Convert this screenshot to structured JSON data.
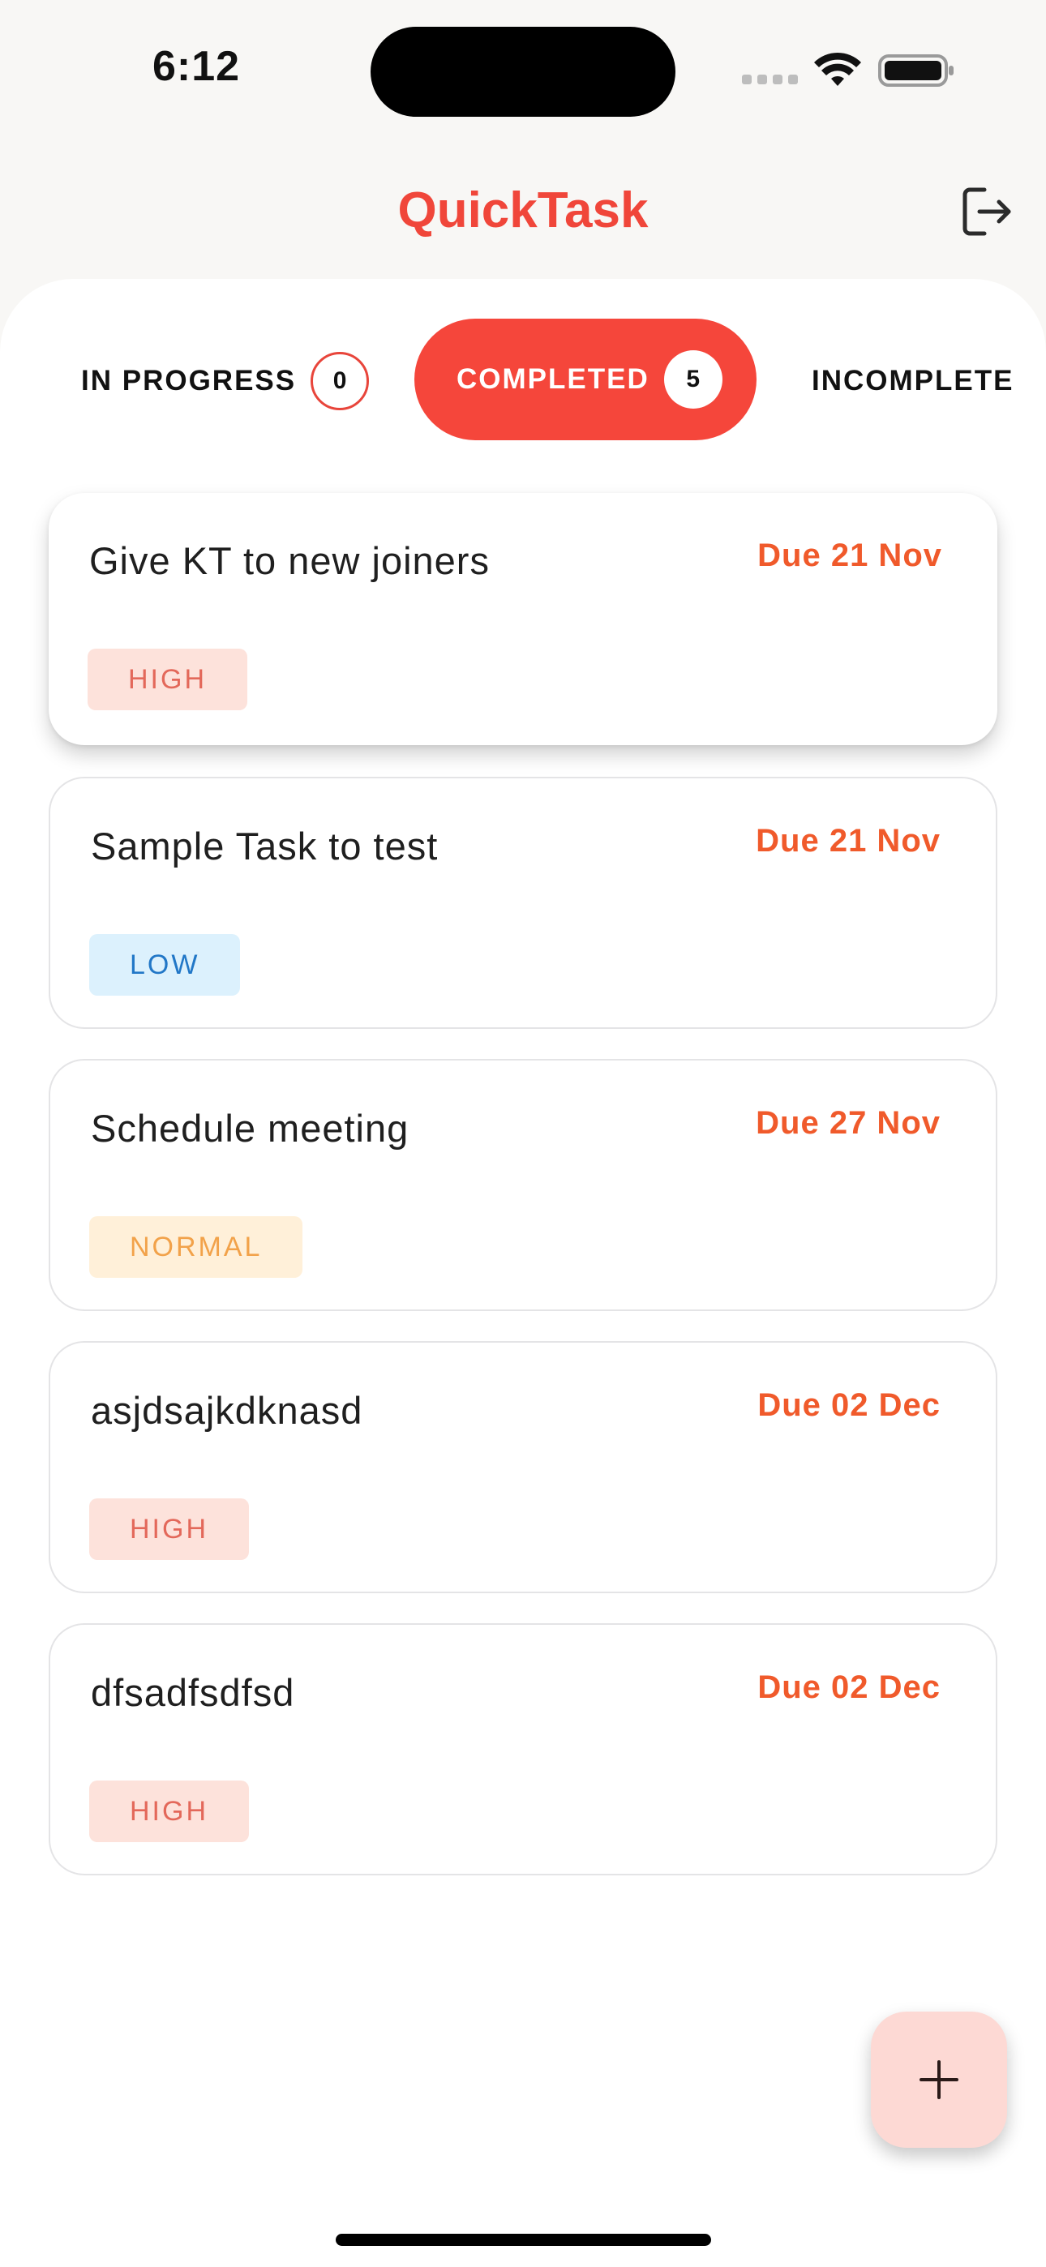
{
  "status_bar": {
    "time": "6:12"
  },
  "header": {
    "title": "QuickTask",
    "logout_icon": "logout-icon"
  },
  "tabs": [
    {
      "label": "IN PROGRESS",
      "count": "0",
      "active": false
    },
    {
      "label": "COMPLETED",
      "count": "5",
      "active": true
    },
    {
      "label": "INCOMPLETE",
      "active": false
    }
  ],
  "tasks": [
    {
      "title": "Give KT to new joiners",
      "due": "Due 21 Nov",
      "priority": "HIGH"
    },
    {
      "title": "Sample Task to test",
      "due": "Due 21 Nov",
      "priority": "LOW"
    },
    {
      "title": "Schedule meeting",
      "due": "Due 27 Nov",
      "priority": "NORMAL"
    },
    {
      "title": "asjdsajkdknasd",
      "due": "Due 02 Dec",
      "priority": "HIGH"
    },
    {
      "title": "dfsadfsdfsd",
      "due": "Due 02 Dec",
      "priority": "HIGH"
    }
  ],
  "fab": {
    "icon": "plus-icon"
  },
  "colors": {
    "accent": "#f5463b",
    "due_text": "#f05a2b",
    "high_bg": "#fde2db",
    "low_bg": "#dcf1fd",
    "normal_bg": "#fff0d9",
    "fab_bg": "#fdd9d4"
  }
}
